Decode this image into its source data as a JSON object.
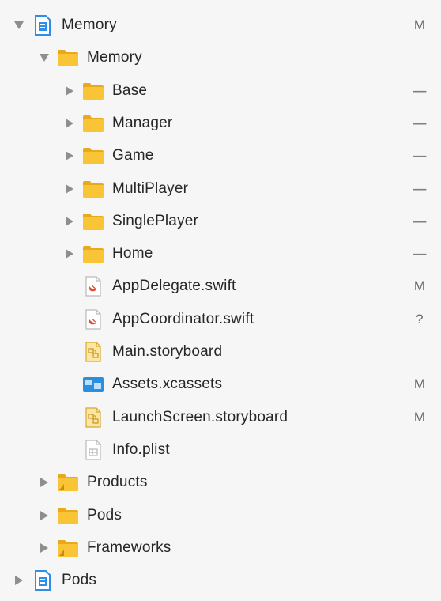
{
  "navigator": {
    "items": [
      {
        "label": "Memory",
        "type": "project",
        "depth": 0,
        "expanded": true,
        "disclosure": "down",
        "status": "M",
        "icon": "project-icon"
      },
      {
        "label": "Memory",
        "type": "folder",
        "depth": 1,
        "expanded": true,
        "disclosure": "down",
        "status": "",
        "icon": "folder-icon"
      },
      {
        "label": "Base",
        "type": "folder",
        "depth": 2,
        "expanded": false,
        "disclosure": "right",
        "status": "—",
        "icon": "folder-icon"
      },
      {
        "label": "Manager",
        "type": "folder",
        "depth": 2,
        "expanded": false,
        "disclosure": "right",
        "status": "—",
        "icon": "folder-icon"
      },
      {
        "label": "Game",
        "type": "folder",
        "depth": 2,
        "expanded": false,
        "disclosure": "right",
        "status": "—",
        "icon": "folder-icon"
      },
      {
        "label": "MultiPlayer",
        "type": "folder",
        "depth": 2,
        "expanded": false,
        "disclosure": "right",
        "status": "—",
        "icon": "folder-icon"
      },
      {
        "label": "SinglePlayer",
        "type": "folder",
        "depth": 2,
        "expanded": false,
        "disclosure": "right",
        "status": "—",
        "icon": "folder-icon"
      },
      {
        "label": "Home",
        "type": "folder",
        "depth": 2,
        "expanded": false,
        "disclosure": "right",
        "status": "—",
        "icon": "folder-icon"
      },
      {
        "label": "AppDelegate.swift",
        "type": "swift",
        "depth": 2,
        "disclosure": "none",
        "status": "M",
        "icon": "swift-file-icon"
      },
      {
        "label": "AppCoordinator.swift",
        "type": "swift",
        "depth": 2,
        "disclosure": "none",
        "status": "?",
        "icon": "swift-file-icon"
      },
      {
        "label": "Main.storyboard",
        "type": "storyboard",
        "depth": 2,
        "disclosure": "none",
        "status": "",
        "icon": "storyboard-file-icon"
      },
      {
        "label": "Assets.xcassets",
        "type": "assets",
        "depth": 2,
        "disclosure": "none",
        "status": "M",
        "icon": "asset-catalog-icon"
      },
      {
        "label": "LaunchScreen.storyboard",
        "type": "storyboard",
        "depth": 2,
        "disclosure": "none",
        "status": "M",
        "icon": "storyboard-file-icon"
      },
      {
        "label": "Info.plist",
        "type": "plist",
        "depth": 2,
        "disclosure": "none",
        "status": "",
        "icon": "plist-file-icon"
      },
      {
        "label": "Products",
        "type": "folder-alt",
        "depth": 1,
        "expanded": false,
        "disclosure": "right",
        "status": "",
        "icon": "products-folder-icon"
      },
      {
        "label": "Pods",
        "type": "folder",
        "depth": 1,
        "expanded": false,
        "disclosure": "right",
        "status": "",
        "icon": "folder-icon"
      },
      {
        "label": "Frameworks",
        "type": "folder-alt",
        "depth": 1,
        "expanded": false,
        "disclosure": "right",
        "status": "",
        "icon": "frameworks-folder-icon"
      },
      {
        "label": "Pods",
        "type": "project",
        "depth": 0,
        "expanded": false,
        "disclosure": "right",
        "status": "",
        "icon": "project-icon"
      }
    ]
  },
  "colors": {
    "background": "#f6f6f6",
    "folder": "#f9c536",
    "folder_dark": "#e8a91e",
    "project_blue": "#2e8ee8",
    "swift_red": "#e8482f",
    "asset_blue": "#2a8fdc",
    "disclosure": "#8e8e8e"
  }
}
